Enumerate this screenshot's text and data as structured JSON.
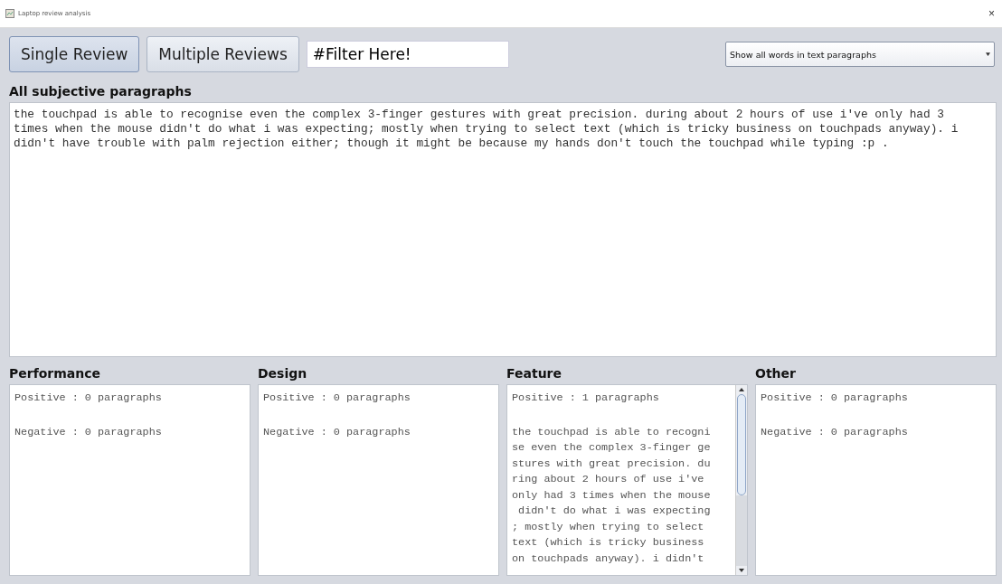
{
  "window": {
    "title": "Laptop review analysis",
    "close": "×"
  },
  "toolbar": {
    "buttons": [
      {
        "label": "Single Review",
        "selected": true
      },
      {
        "label": "Multiple Reviews",
        "selected": false
      }
    ],
    "filter": {
      "value": "#Filter Here!"
    },
    "dropdown": {
      "value": "Show all words in text paragraphs"
    }
  },
  "main": {
    "heading": "All subjective paragraphs",
    "lines": [
      "the touchpad is able to recognise even the complex 3-finger gestures with great precision. during about 2 hours of use i've only had 3",
      "times when the mouse didn't do what i was expecting; mostly when trying to select text (which is tricky business on touchpads anyway). i",
      "didn't have trouble with palm rejection either; though it might be because my hands don't touch the touchpad while typing :p ."
    ]
  },
  "categories": [
    {
      "title": "Performance",
      "positive": "Positive : 0 paragraphs",
      "negative": "Negative : 0 paragraphs",
      "scrollbar": false
    },
    {
      "title": "Design",
      "positive": "Positive : 0 paragraphs",
      "negative": "Negative : 0 paragraphs",
      "scrollbar": false
    },
    {
      "title": "Feature",
      "positive": "Positive : 1 paragraphs",
      "lines": [
        "the touchpad is able to recogni",
        "se even the complex 3-finger ge",
        "stures with great precision. du",
        "ring about 2 hours of use i've",
        "only had 3 times when the mouse",
        " didn't do what i was expecting",
        "; mostly when trying to select",
        "text (which is tricky business",
        "on touchpads anyway). i didn't"
      ],
      "scrollbar": true
    },
    {
      "title": "Other",
      "positive": "Positive : 0 paragraphs",
      "negative": "Negative : 0 paragraphs",
      "scrollbar": false
    }
  ]
}
